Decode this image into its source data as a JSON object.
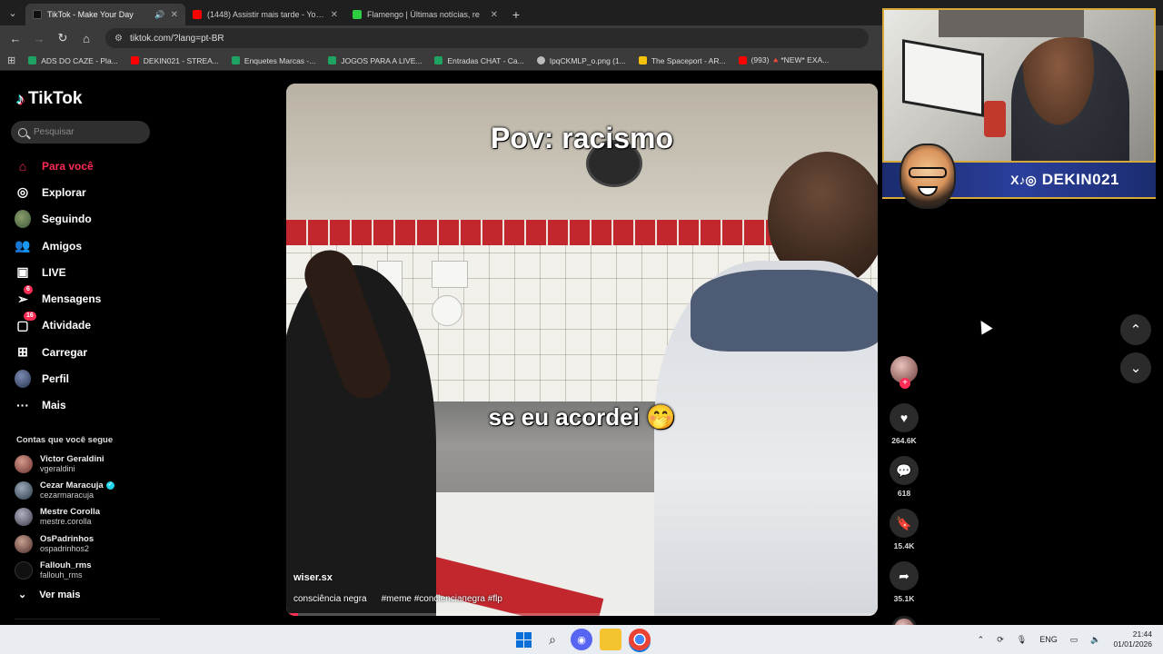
{
  "browser": {
    "tabs": [
      {
        "title": "TikTok - Make Your Day",
        "active": true,
        "favicon_color": "#000000",
        "has_sound": true
      },
      {
        "title": "(1448) Assistir mais tarde - YouTube",
        "active": false,
        "favicon_color": "#ff0000"
      },
      {
        "title": "Flamengo | Últimas notícias, re",
        "active": false,
        "favicon_color": "#2ecc40"
      }
    ],
    "url": "tiktok.com/?lang=pt-BR",
    "bookmarks": [
      {
        "label": "ADS DO CAZE - Pla...",
        "color": "#1ea362"
      },
      {
        "label": "DEKIN021 - STREA...",
        "color": "#ff0000"
      },
      {
        "label": "Enquetes Marcas -...",
        "color": "#1ea362"
      },
      {
        "label": "JOGOS PARA A LIVE...",
        "color": "#1ea362"
      },
      {
        "label": "Entradas CHAT - Ca...",
        "color": "#1ea362"
      },
      {
        "label": "IpqCKMLP_o.png (1...",
        "color": "#bbbbbb"
      },
      {
        "label": "The Spaceport - AR...",
        "color": "#f4c20d"
      },
      {
        "label": "(993) 🔺*NEW* EXA...",
        "color": "#ff0000"
      }
    ]
  },
  "sidebar": {
    "brand": "TikTok",
    "search_placeholder": "Pesquisar",
    "items": [
      {
        "label": "Para você",
        "icon": "home-icon",
        "glyph": "⌂",
        "active": true
      },
      {
        "label": "Explorar",
        "icon": "compass-icon",
        "glyph": "◎"
      },
      {
        "label": "Seguindo",
        "icon": "following-avatar-icon",
        "glyph": ""
      },
      {
        "label": "Amigos",
        "icon": "friends-icon",
        "glyph": "👥"
      },
      {
        "label": "LIVE",
        "icon": "live-icon",
        "glyph": "▣"
      },
      {
        "label": "Mensagens",
        "icon": "messages-icon",
        "glyph": "➢",
        "badge": "6"
      },
      {
        "label": "Atividade",
        "icon": "activity-icon",
        "glyph": "▢",
        "badge": "16"
      },
      {
        "label": "Carregar",
        "icon": "upload-icon",
        "glyph": "⊞"
      },
      {
        "label": "Perfil",
        "icon": "profile-icon",
        "glyph": ""
      },
      {
        "label": "Mais",
        "icon": "more-icon",
        "glyph": "···"
      }
    ],
    "following_title": "Contas que você segue",
    "following": [
      {
        "name": "Victor Geraldini",
        "handle": "vgeraldini",
        "color": "#8a4a4a"
      },
      {
        "name": "Cezar Maracuja",
        "handle": "cezarmaracuja",
        "verified": true,
        "color": "#4a5a6a"
      },
      {
        "name": "Mestre Corolla",
        "handle": "mestre.corolla",
        "color": "#6a6a7a"
      },
      {
        "name": "OsPadrinhos",
        "handle": "ospadrinhos2",
        "color": "#7a5a5a"
      },
      {
        "name": "Fallouh_rms",
        "handle": "fallouh_rms",
        "color": "#111111"
      }
    ],
    "see_more": "Ver mais"
  },
  "video": {
    "top_text": "Pov: racismo",
    "middle_text": "se eu acordei 🤭",
    "author": "wiser.sx",
    "caption_text": "consciência negra",
    "hashtags": "#meme #concienciaпegra #flp",
    "progress": 0.02
  },
  "actions": {
    "likes": "264.6K",
    "comments": "618",
    "saves": "15.4K",
    "shares": "35.1K"
  },
  "overlay": {
    "handle": "DEKIN021",
    "socials": "X♪◎"
  },
  "taskbar": {
    "language": "ENG",
    "time": "21:44",
    "date": "01/01/2026"
  }
}
